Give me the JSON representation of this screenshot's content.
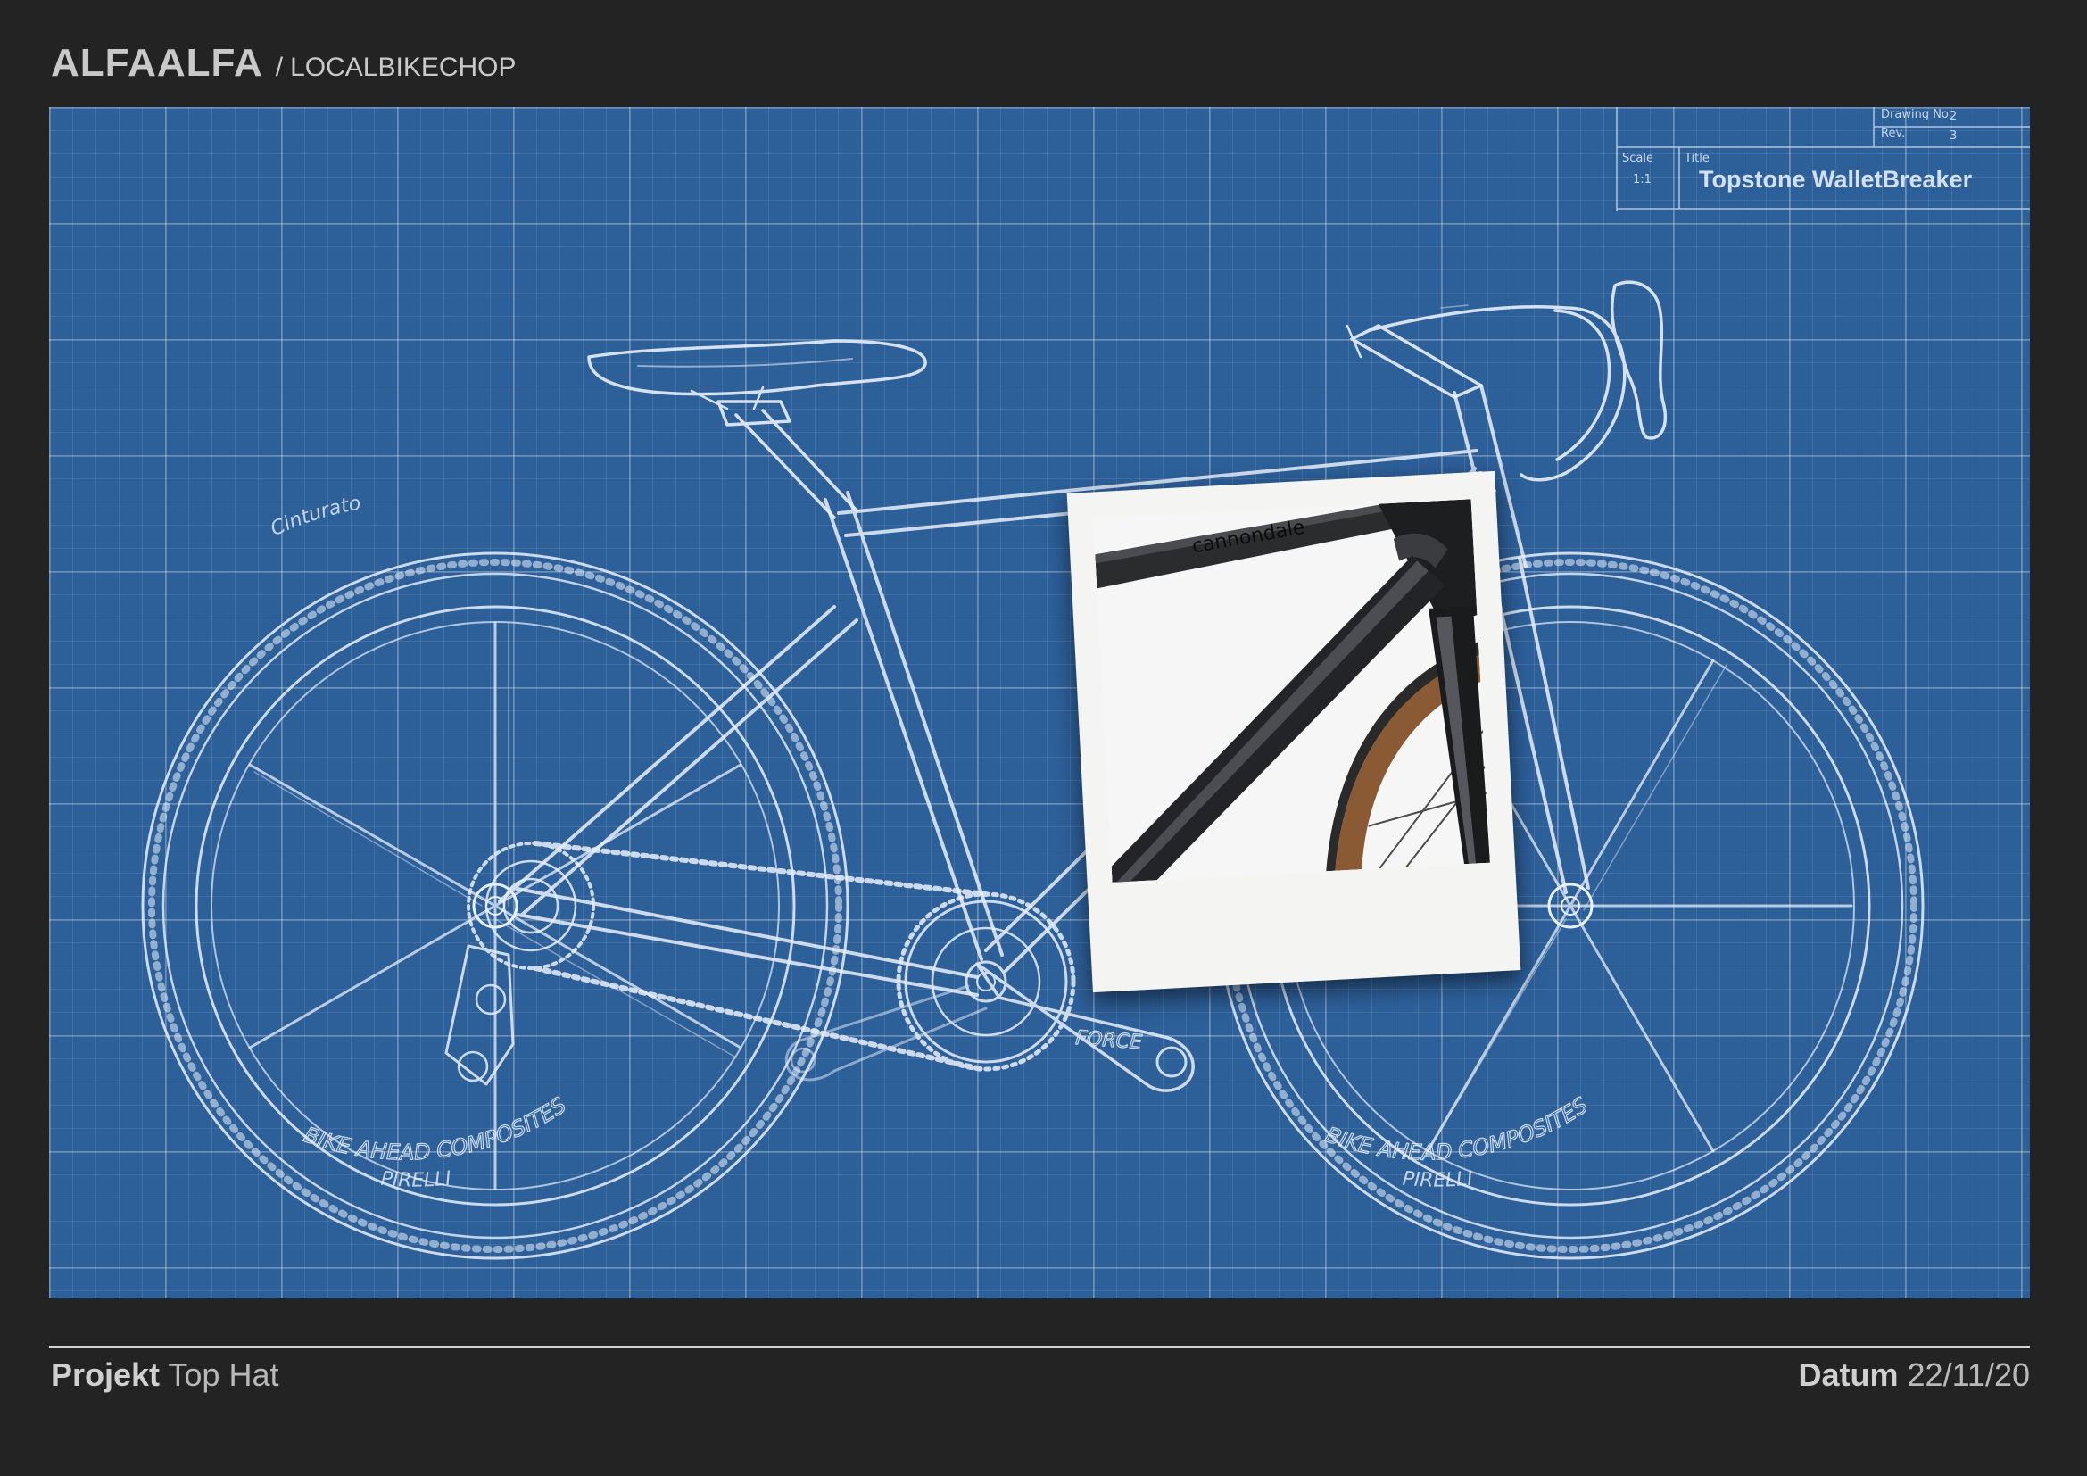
{
  "header": {
    "brand": "ALFAALFA",
    "separator": "/",
    "subtitle": "LOCALBIKECHOP"
  },
  "title_block": {
    "drawing_no_label": "Drawing No.",
    "drawing_no_value": "2",
    "rev_label": "Rev.",
    "rev_value": "3",
    "scale_label": "Scale",
    "scale_value": "1:1",
    "title_label": "Title",
    "title_value": "Topstone WalletBreaker"
  },
  "bike_text": {
    "tire_brand_top": "Cinturato",
    "tire_brand_bottom": "PIRELLI",
    "rim_brand": "BIKE AHEAD COMPOSITES",
    "crank_brand": "FORCE"
  },
  "photo": {
    "frame_brand": "cannondale"
  },
  "footer": {
    "project_label": "Projekt",
    "project_value": "Top Hat",
    "date_label": "Datum",
    "date_value": "22/11/20"
  },
  "colors": {
    "background": "#232323",
    "blueprint": "#2d5f99",
    "line": "#e8f0fb"
  }
}
